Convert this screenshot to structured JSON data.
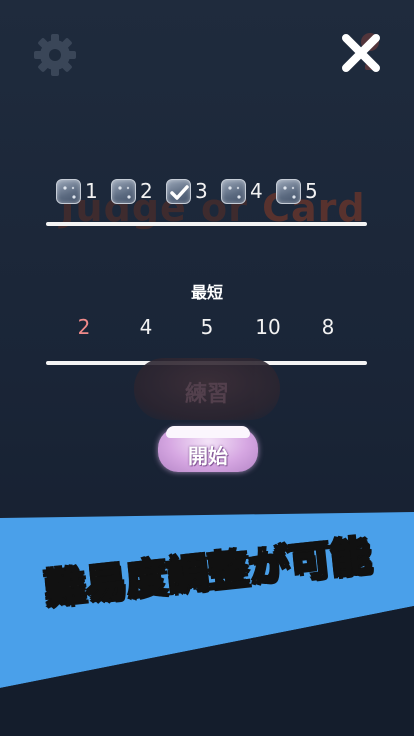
{
  "background_title": {
    "part1": "Judge or ",
    "part2": "Card"
  },
  "checkboxes": [
    {
      "label": "1",
      "checked": false
    },
    {
      "label": "2",
      "checked": false
    },
    {
      "label": "3",
      "checked": true
    },
    {
      "label": "4",
      "checked": false
    },
    {
      "label": "5",
      "checked": false
    }
  ],
  "shortest": {
    "label": "最短",
    "options": [
      "2",
      "4",
      "5",
      "10",
      "8"
    ],
    "selected": "2"
  },
  "buttons": {
    "practice": "練習",
    "start": "開始"
  },
  "promo": {
    "text": "難易度調整が可能"
  },
  "colors": {
    "accent_blue": "#4aa0ea",
    "selected_number": "#f08a8a",
    "start_button": "#d6a7e2"
  },
  "icons": {
    "settings": "gear-icon",
    "close": "close-icon"
  }
}
